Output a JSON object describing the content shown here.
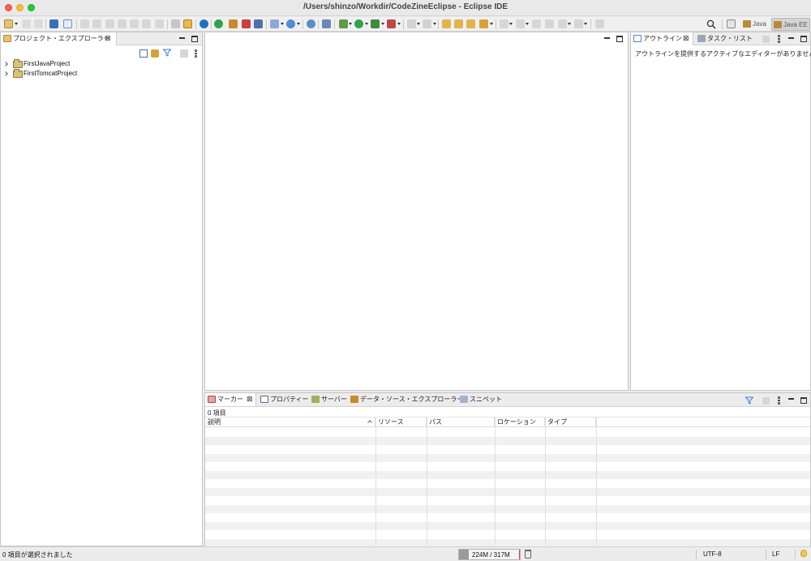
{
  "window": {
    "title": "/Users/shinzo/Workdir/CodeZineEclipse - Eclipse IDE"
  },
  "toolbar": {
    "perspectives": [
      {
        "label": "Java",
        "active": false
      },
      {
        "label": "Java EE",
        "active": true
      }
    ]
  },
  "project_explorer": {
    "tab_label": "プロジェクト・エクスプローラー",
    "projects": [
      {
        "name": "FirstJavaProject"
      },
      {
        "name": "FirstTomcatProject"
      }
    ]
  },
  "outline": {
    "tabs": [
      {
        "label": "アウトライン",
        "active": true
      },
      {
        "label": "タスク・リスト",
        "active": false
      }
    ],
    "message": "アウトラインを提供するアクティブなエディターがありません。"
  },
  "bottom_panel": {
    "tabs": [
      {
        "label": "マーカー",
        "active": true
      },
      {
        "label": "プロパティー",
        "active": false
      },
      {
        "label": "サーバー",
        "active": false
      },
      {
        "label": "データ・ソース・エクスプローラー",
        "active": false
      },
      {
        "label": "スニペット",
        "active": false
      }
    ],
    "item_count": "0 項目",
    "columns": [
      "説明",
      "リソース",
      "パス",
      "ロケーション",
      "タイプ"
    ]
  },
  "status_bar": {
    "selection_text": "0 項目が選択されました",
    "heap": "224M / 317M",
    "heap_used_fraction": 0.71,
    "encoding": "UTF-8",
    "line_delimiter": "LF"
  },
  "colors": {
    "accent_blue": "#3d7bd9",
    "heap_marker": "#e04040"
  }
}
